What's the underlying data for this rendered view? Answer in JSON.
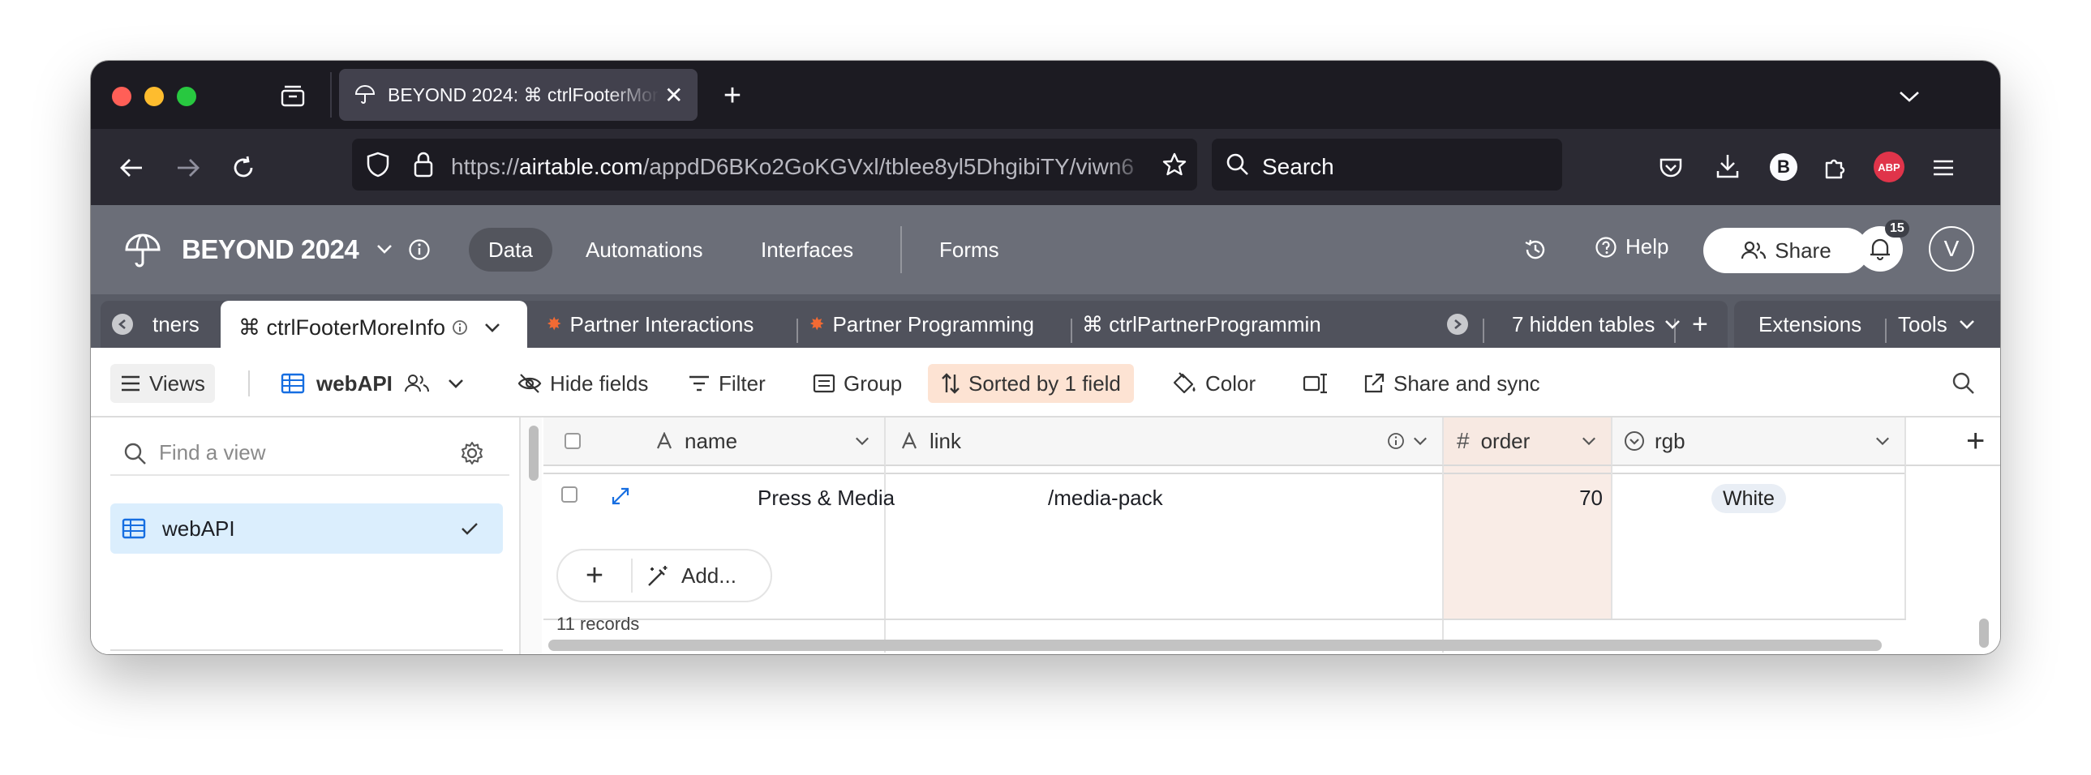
{
  "browser": {
    "tab_title": "BEYOND 2024: ⌘ ctrlFooterMoreInfo",
    "url_domain": "airtable.com",
    "url_prefix": "https://",
    "url_path": "/appdD6BKo2GoKGVxl/tblee8yl5DhgibiTY/viwn6",
    "search_placeholder": "Search",
    "profile_letter": "B",
    "adblock_label": "ABP"
  },
  "header": {
    "base_name": "BEYOND 2024",
    "nav": [
      "Data",
      "Automations",
      "Interfaces",
      "Forms"
    ],
    "help_label": "Help",
    "share_label": "Share",
    "notification_count": "15",
    "avatar_letter": "V"
  },
  "table_tabs": {
    "prev_partial": "tners",
    "active": "⌘ ctrlFooterMoreInfo",
    "items": [
      "Partner Interactions",
      "Partner Programming",
      "⌘ ctrlPartnerProgrammin"
    ],
    "hidden_tables": "7 hidden tables",
    "extensions": "Extensions",
    "tools": "Tools"
  },
  "viewbar": {
    "views_label": "Views",
    "view_name": "webAPI",
    "hide_fields": "Hide fields",
    "filter": "Filter",
    "group": "Group",
    "sorted": "Sorted by 1 field",
    "color": "Color",
    "share_sync": "Share and sync"
  },
  "sidebar": {
    "find_placeholder": "Find a view",
    "views": [
      {
        "name": "webAPI",
        "selected": true
      }
    ]
  },
  "grid": {
    "columns": [
      {
        "name": "name",
        "type": "text"
      },
      {
        "name": "link",
        "type": "text"
      },
      {
        "name": "order",
        "type": "number"
      },
      {
        "name": "rgb",
        "type": "select"
      }
    ],
    "rows": [
      {
        "name": "Press & Media",
        "link": "/media-pack",
        "order": "70",
        "rgb": "White"
      }
    ],
    "add_label": "Add...",
    "record_count": "11 records"
  },
  "colors": {
    "tabbar_bg": "#1c1b22",
    "navbar_bg": "#2b2a33",
    "header_bg": "#6b6e78",
    "sorted_highlight": "#fde3d3",
    "selected_view": "#dbeefd"
  }
}
